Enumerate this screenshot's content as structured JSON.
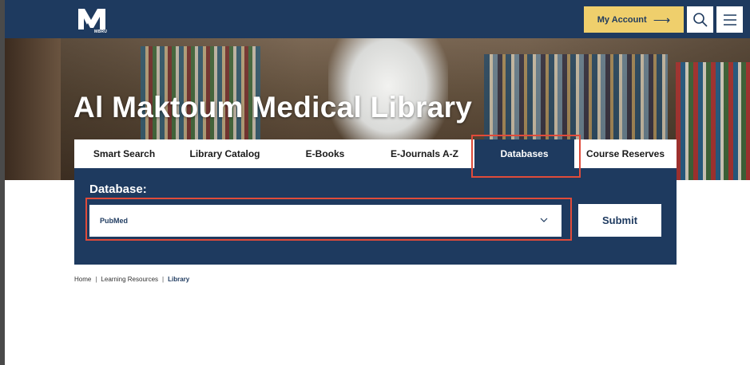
{
  "header": {
    "logo_text": "MBRU",
    "account_label": "My Account",
    "account_arrow": "⟶",
    "search_icon": "search-icon",
    "menu_icon": "hamburger-icon"
  },
  "hero": {
    "title": "Al Maktoum Medical Library"
  },
  "tabs": [
    {
      "label": "Smart Search"
    },
    {
      "label": "Library Catalog"
    },
    {
      "label": "E-Books"
    },
    {
      "label": "E-Journals A-Z"
    },
    {
      "label": "Databases",
      "active": true
    },
    {
      "label": "Course Reserves"
    }
  ],
  "database_panel": {
    "label": "Database:",
    "selected_value": "PubMed",
    "submit_label": "Submit"
  },
  "breadcrumb": {
    "items": [
      "Home",
      "Learning Resources",
      "Library"
    ],
    "separator": "|"
  },
  "colors": {
    "navy": "#1e3a5f",
    "accent_yellow": "#efcf6c",
    "highlight_red": "#e04b3a"
  }
}
